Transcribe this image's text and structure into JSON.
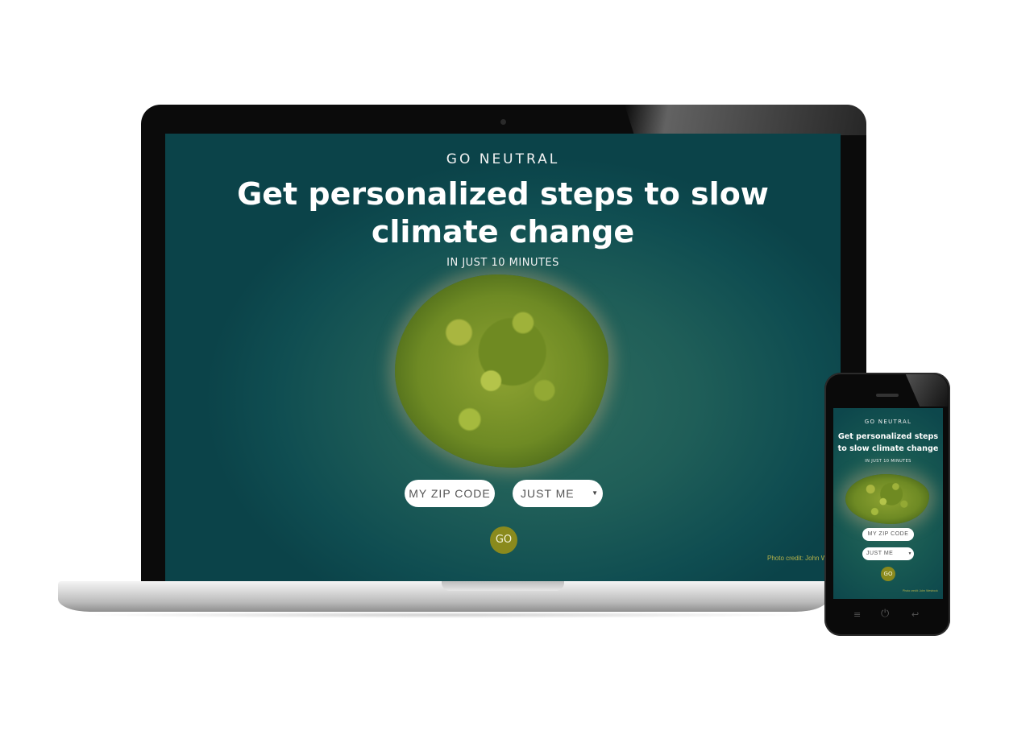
{
  "site": {
    "brand": "GO NEUTRAL",
    "headline": "Get personalized steps to slow climate change",
    "subheadline": "IN JUST 10 MINUTES",
    "zip_button": "MY ZIP CODE",
    "household_select": {
      "selected": "JUST ME"
    },
    "go_button": "GO",
    "photo_credit": "Photo credit: John Westrock"
  },
  "phone_nav": {
    "menu_icon": "menu-icon",
    "power_icon": "power-icon",
    "back_icon": "back-icon"
  },
  "colors": {
    "background_teal": "#0f4d51",
    "go_button": "#8a8a1d",
    "credit_text": "#b7b24a"
  }
}
